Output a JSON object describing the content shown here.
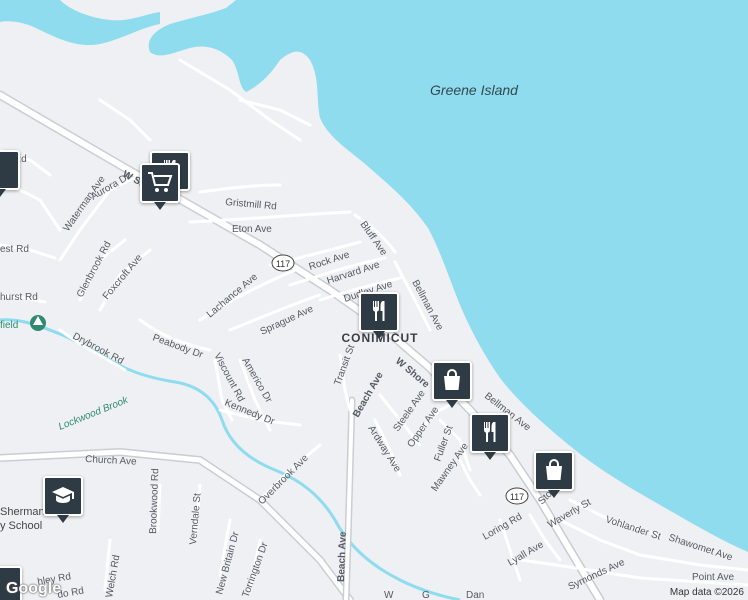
{
  "water": {
    "island": "Greene Island",
    "brook": "Lockwood Brook"
  },
  "place": "CONIMICUT",
  "route_shield": "117",
  "roads": {
    "w_shore_rd_north": "W Shore Rd",
    "w_shore_rd_south": "W Shore",
    "gristmill": "Gristmill Rd",
    "eton": "Eton Ave",
    "bluff": "Bluff Ave",
    "rock": "Rock Ave",
    "harvard": "Harvard Ave",
    "dudley": "Dudley Ave",
    "bellman_north": "Bellman Ave",
    "bellman_south": "Bellman Ave",
    "lachance": "Lachance Ave",
    "sprague": "Sprague Ave",
    "waterman": "Waterman Ave",
    "aurora": "Aurora Dr",
    "glenbrook": "Glenbrook Rd",
    "foxcroft": "Foxcroft Ave",
    "drybrook": "Drybrook Rd",
    "peabody": "Peabody Dr",
    "viscount": "Viscount Rd",
    "americo": "Americo Dr",
    "kennedy": "Kennedy Dr",
    "transit": "Transit St",
    "beach_ave_north": "Beach Ave",
    "beach_ave_south": "Beach Ave",
    "steele": "Steele Ave",
    "opper": "Opper Ave",
    "ardway": "Ardway Ave",
    "fuller": "Fuller St",
    "mawney": "Mawney Ave",
    "stokes": "Stokes",
    "church": "Church Ave",
    "overbrook": "Overbrook Ave",
    "brookwood": "Brookwood Rd",
    "verndale": "Verndale St",
    "new_britain": "New Britain Dr",
    "torrington": "Torrington Dr",
    "welch": "Welch Rd",
    "loring": "Loring Rd",
    "waverly": "Waverly St",
    "vohlander": "Vohlander St",
    "shawomet": "Shawomet Ave",
    "lyall": "Lyall Ave",
    "symonds": "Symonds Ave",
    "point": "Point Ave",
    "wood_partial": "od Rd",
    "west_partial": "est Rd",
    "hurst_partial": "hurst Rd",
    "field_partial": "field",
    "sherman_partial": "Sherman",
    "school_partial": "y School",
    "hley_partial": "hley Rd",
    "do_partial": "do Rd",
    "g_partial": "G",
    "dan_partial": "Dan",
    "w_partial": "W"
  },
  "pois": [
    {
      "name": "restaurant",
      "icon": "fork-knife-icon"
    },
    {
      "name": "grocery",
      "icon": "shopping-cart-icon"
    },
    {
      "name": "restaurant",
      "icon": "fork-knife-icon"
    },
    {
      "name": "shopping",
      "icon": "shopping-bag-icon"
    },
    {
      "name": "restaurant",
      "icon": "fork-knife-icon"
    },
    {
      "name": "shopping",
      "icon": "shopping-bag-icon"
    },
    {
      "name": "school",
      "icon": "graduation-cap-icon"
    }
  ],
  "colors": {
    "water": "#8fdcef",
    "land": "#eef0f3",
    "road": "#ffffff",
    "major_road": "#c9ced4",
    "brook": "#8fdcef",
    "park": "#2e8b6f"
  },
  "footer": {
    "logo": "Google",
    "attribution": "Map data ©2026"
  }
}
